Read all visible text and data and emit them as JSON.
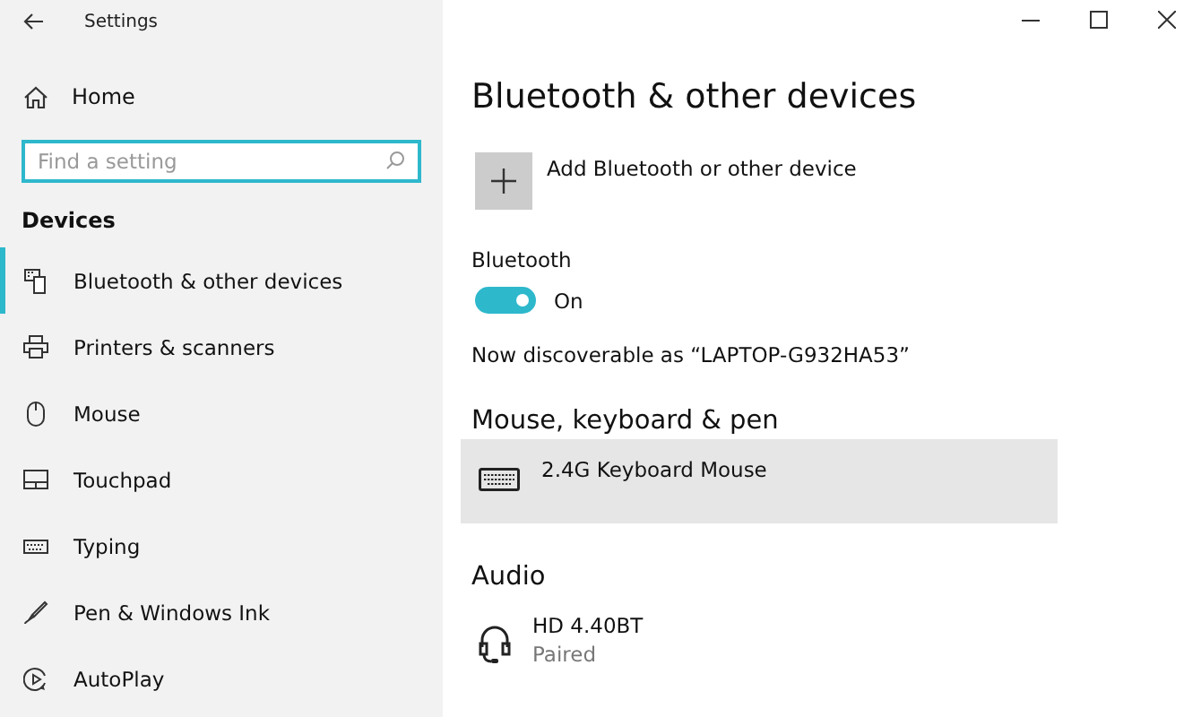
{
  "window": {
    "title": "Settings"
  },
  "sidebar": {
    "home": "Home",
    "search": {
      "placeholder": "Find a setting"
    },
    "section": "Devices",
    "items": [
      {
        "label": "Bluetooth & other devices",
        "kind": "bluetooth",
        "selected": true
      },
      {
        "label": "Printers & scanners",
        "kind": "printer",
        "selected": false
      },
      {
        "label": "Mouse",
        "kind": "mouse",
        "selected": false
      },
      {
        "label": "Touchpad",
        "kind": "touchpad",
        "selected": false
      },
      {
        "label": "Typing",
        "kind": "typing",
        "selected": false
      },
      {
        "label": "Pen & Windows Ink",
        "kind": "pen",
        "selected": false
      },
      {
        "label": "AutoPlay",
        "kind": "autoplay",
        "selected": false
      }
    ]
  },
  "main": {
    "heading": "Bluetooth & other devices",
    "add_button": "Add Bluetooth or other device",
    "bluetooth": {
      "label": "Bluetooth",
      "on": true,
      "state_text": "On"
    },
    "discoverable": "Now discoverable as “LAPTOP-G932HA53”",
    "sections": [
      {
        "title": "Mouse, keyboard & pen",
        "devices": [
          {
            "name": "2.4G Keyboard Mouse",
            "kind": "keyboard",
            "selected": true
          }
        ]
      },
      {
        "title": "Audio",
        "devices": [
          {
            "name": "HD 4.40BT",
            "status": "Paired",
            "kind": "headset",
            "selected": false
          }
        ]
      }
    ]
  }
}
